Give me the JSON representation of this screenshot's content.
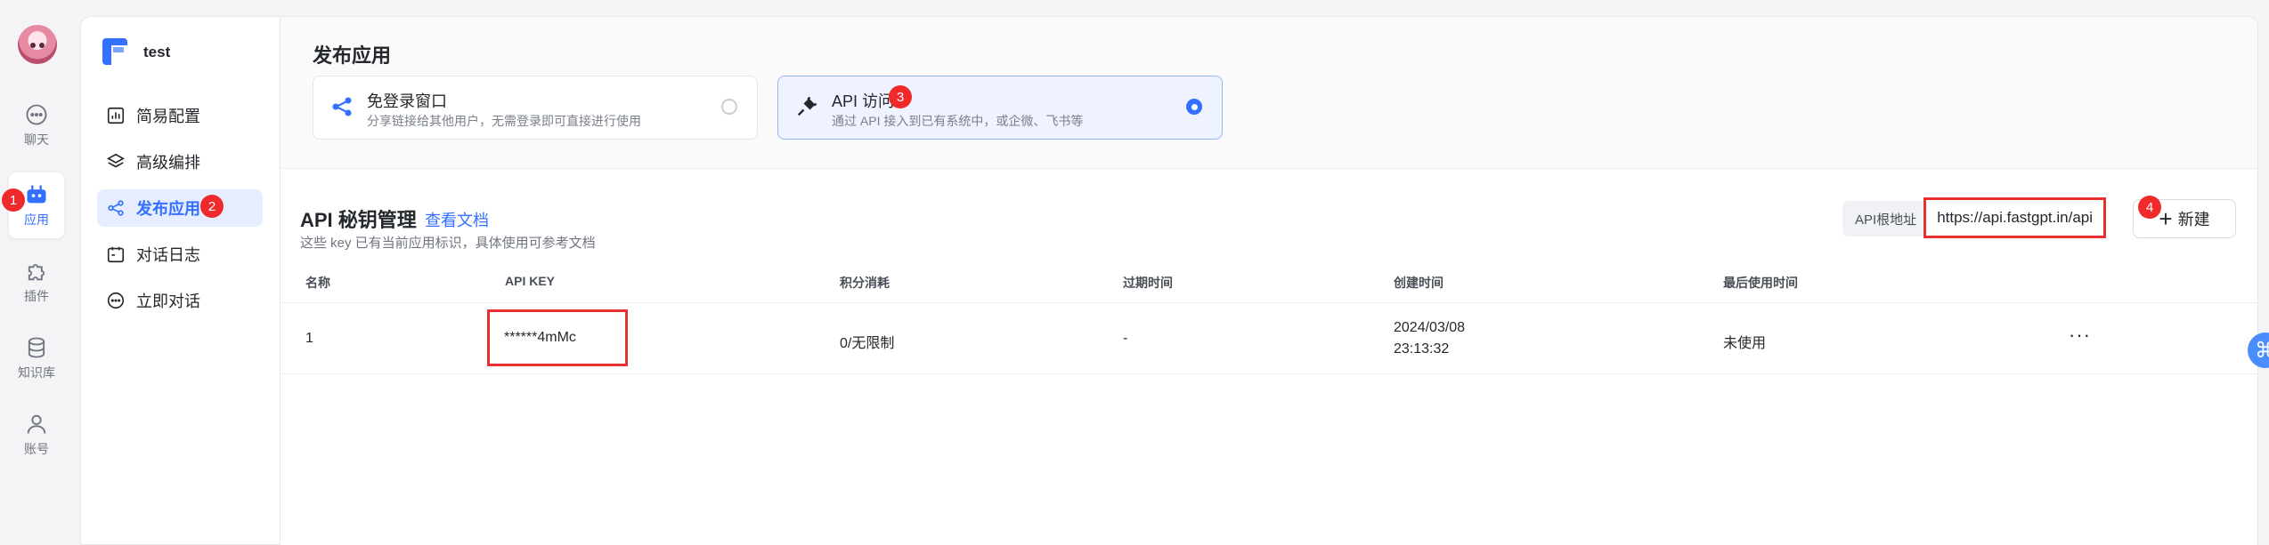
{
  "nav": {
    "items": [
      {
        "label": "聊天",
        "icon": "chat-icon"
      },
      {
        "label": "应用",
        "icon": "robot-icon",
        "active": true
      },
      {
        "label": "插件",
        "icon": "puzzle-icon"
      },
      {
        "label": "知识库",
        "icon": "database-icon"
      },
      {
        "label": "账号",
        "icon": "user-icon"
      }
    ]
  },
  "badges": [
    "1",
    "2",
    "3",
    "4"
  ],
  "app": {
    "name": "test"
  },
  "menu": {
    "items": [
      {
        "label": "简易配置",
        "icon": "chart-icon"
      },
      {
        "label": "高级编排",
        "icon": "layers-icon"
      },
      {
        "label": "发布应用",
        "icon": "share-icon",
        "active": true
      },
      {
        "label": "对话日志",
        "icon": "calendar-icon"
      },
      {
        "label": "立即对话",
        "icon": "chat-icon"
      }
    ]
  },
  "publish": {
    "title": "发布应用",
    "options": [
      {
        "title": "免登录窗口",
        "desc": "分享链接给其他用户，无需登录即可直接进行使用",
        "selected": false
      },
      {
        "title": "API 访问",
        "desc": "通过 API 接入到已有系统中，或企微、飞书等",
        "selected": true
      }
    ]
  },
  "api_keys": {
    "title": "API 秘钥管理",
    "doc_link": "查看文档",
    "desc": "这些 key 已有当前应用标识，具体使用可参考文档",
    "root_label": "API根地址",
    "root_url": "https://api.fastgpt.in/api",
    "new_button": "新建",
    "columns": [
      "名称",
      "API KEY",
      "积分消耗",
      "过期时间",
      "创建时间",
      "最后使用时间"
    ],
    "rows": [
      {
        "name": "1",
        "key": "******4mMc",
        "usage": "0/无限制",
        "expire": "-",
        "created_date": "2024/03/08",
        "created_time": "23:13:32",
        "last_used": "未使用",
        "more": "···"
      }
    ]
  },
  "colors": {
    "accent": "#3370ff",
    "highlight": "#e8302f",
    "badge": "#f02a2a"
  }
}
